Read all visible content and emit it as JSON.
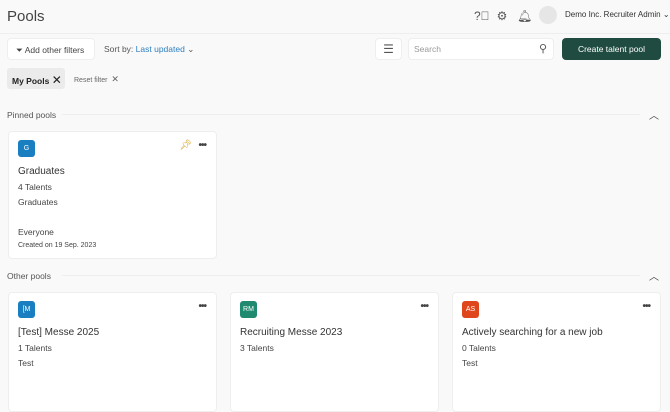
{
  "header": {
    "title": "Pools",
    "user": "Demo Inc. Recruiter Admin"
  },
  "toolbar": {
    "filters": "Add other filters",
    "sort_label": "Sort by:",
    "sort_value": "Last updated",
    "search_placeholder": "Search",
    "create": "Create talent pool"
  },
  "chips": {
    "active": "My Pools",
    "reset": "Reset filter"
  },
  "pinned": {
    "title": "Pools",
    "label": "Pinned pools",
    "cards": [
      {
        "initials": "G",
        "color": "#1a7fc1",
        "name": "Graduates",
        "talents": "4 Talents",
        "desc": "Graduates",
        "visibility": "Everyone",
        "created": "Created on 19 Sep. 2023"
      }
    ]
  },
  "other": {
    "label": "Other pools",
    "cards": [
      {
        "initials": "[M",
        "color": "#1a7fc1",
        "name": "[Test] Messe 2025",
        "talents": "1 Talents",
        "desc": "Test"
      },
      {
        "initials": "RM",
        "color": "#1f8a70",
        "name": "Recruiting Messe 2023",
        "talents": "3 Talents",
        "desc": ""
      },
      {
        "initials": "AS",
        "color": "#e0461c",
        "name": "Actively searching for a new job",
        "talents": "0 Talents",
        "desc": "Test"
      }
    ]
  }
}
